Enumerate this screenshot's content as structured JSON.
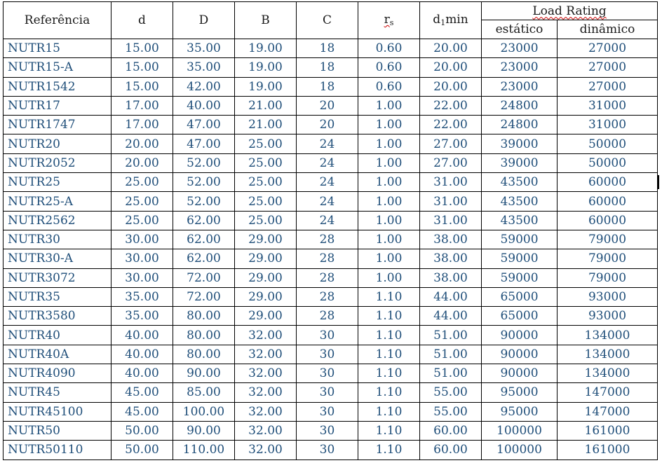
{
  "headers": {
    "ref": "Referência",
    "d": "d",
    "D": "D",
    "B": "B",
    "C": "C",
    "rs_main": "r",
    "rs_sub": "s",
    "d1_main": "d",
    "d1_sub": "1",
    "d1_suffix": "min",
    "load_rating": "Load Rating",
    "static": "estático",
    "dynamic": "dinâmico"
  },
  "rows": [
    [
      "NUTR15",
      "15.00",
      "35.00",
      "19.00",
      "18",
      "0.60",
      "20.00",
      "23000",
      "27000"
    ],
    [
      "NUTR15-A",
      "15.00",
      "35.00",
      "19.00",
      "18",
      "0.60",
      "20.00",
      "23000",
      "27000"
    ],
    [
      "NUTR1542",
      "15.00",
      "42.00",
      "19.00",
      "18",
      "0.60",
      "20.00",
      "23000",
      "27000"
    ],
    [
      "NUTR17",
      "17.00",
      "40.00",
      "21.00",
      "20",
      "1.00",
      "22.00",
      "24800",
      "31000"
    ],
    [
      "NUTR1747",
      "17.00",
      "47.00",
      "21.00",
      "20",
      "1.00",
      "22.00",
      "24800",
      "31000"
    ],
    [
      "NUTR20",
      "20.00",
      "47.00",
      "25.00",
      "24",
      "1.00",
      "27.00",
      "39000",
      "50000"
    ],
    [
      "NUTR2052",
      "20.00",
      "52.00",
      "25.00",
      "24",
      "1.00",
      "27.00",
      "39000",
      "50000"
    ],
    [
      "NUTR25",
      "25.00",
      "52.00",
      "25.00",
      "24",
      "1.00",
      "31.00",
      "43500",
      "60000"
    ],
    [
      "NUTR25-A",
      "25.00",
      "52.00",
      "25.00",
      "24",
      "1.00",
      "31.00",
      "43500",
      "60000"
    ],
    [
      "NUTR2562",
      "25.00",
      "62.00",
      "25.00",
      "24",
      "1.00",
      "31.00",
      "43500",
      "60000"
    ],
    [
      "NUTR30",
      "30.00",
      "62.00",
      "29.00",
      "28",
      "1.00",
      "38.00",
      "59000",
      "79000"
    ],
    [
      "NUTR30-A",
      "30.00",
      "62.00",
      "29.00",
      "28",
      "1.00",
      "38.00",
      "59000",
      "79000"
    ],
    [
      "NUTR3072",
      "30.00",
      "72.00",
      "29.00",
      "28",
      "1.00",
      "38.00",
      "59000",
      "79000"
    ],
    [
      "NUTR35",
      "35.00",
      "72.00",
      "29.00",
      "28",
      "1.10",
      "44.00",
      "65000",
      "93000"
    ],
    [
      "NUTR3580",
      "35.00",
      "80.00",
      "29.00",
      "28",
      "1.10",
      "44.00",
      "65000",
      "93000"
    ],
    [
      "NUTR40",
      "40.00",
      "80.00",
      "32.00",
      "30",
      "1.10",
      "51.00",
      "90000",
      "134000"
    ],
    [
      "NUTR40A",
      "40.00",
      "80.00",
      "32.00",
      "30",
      "1.10",
      "51.00",
      "90000",
      "134000"
    ],
    [
      "NUTR4090",
      "40.00",
      "90.00",
      "32.00",
      "30",
      "1.10",
      "51.00",
      "90000",
      "134000"
    ],
    [
      "NUTR45",
      "45.00",
      "85.00",
      "32.00",
      "30",
      "1.10",
      "55.00",
      "95000",
      "147000"
    ],
    [
      "NUTR45100",
      "45.00",
      "100.00",
      "32.00",
      "30",
      "1.10",
      "55.00",
      "95000",
      "147000"
    ],
    [
      "NUTR50",
      "50.00",
      "90.00",
      "32.00",
      "30",
      "1.10",
      "60.00",
      "100000",
      "161000"
    ],
    [
      "NUTR50110",
      "50.00",
      "110.00",
      "32.00",
      "30",
      "1.10",
      "60.00",
      "100000",
      "161000"
    ]
  ],
  "colors": {
    "value_text": "#1f4e79",
    "header_text": "#1a1a1a",
    "border": "#000000",
    "spell_underline": "#cc0000"
  }
}
